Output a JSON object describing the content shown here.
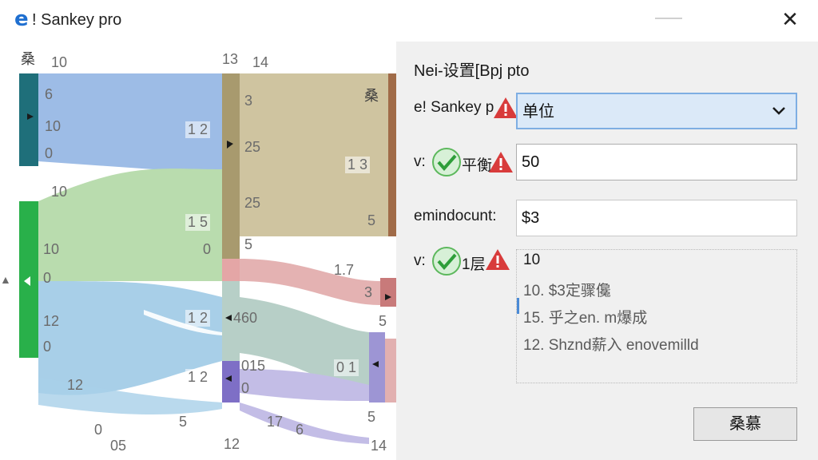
{
  "window": {
    "app_icon_glyph": "e",
    "title": "! Sankey pro",
    "close_glyph": "✕"
  },
  "chart": {
    "colors": {
      "teal": "#1f6f7a",
      "green": "#29b04a",
      "blue_flow": "#9dbce6",
      "green_flow": "#b9dcae",
      "lightblue_flow": "#a8cfe8",
      "tan": "#a89a6e",
      "tan_flow": "#cfc4a0",
      "pink_flow": "#e4b2b2",
      "purple": "#7e6fc6",
      "purple_flow": "#c3bde6",
      "brown": "#a06b48",
      "rose": "#c87a7a",
      "gray_teal_flow": "#b7cfc7"
    },
    "labels": {
      "top_left_glyph": "桑",
      "top_left_num": "10",
      "teal_a": "6",
      "teal_b": "10",
      "teal_c": "0",
      "green_top": "10",
      "green_a": "10",
      "green_b": "0",
      "green_c": "12",
      "green_d": "0",
      "left_edge": "▲",
      "bottom_a": "12",
      "bottom_b": "0",
      "bottom_c": "05",
      "bottom_d": "5",
      "mid_top_a": "13",
      "mid_top_b": "14",
      "mid_a": "1 2",
      "mid_b": "1 5",
      "mid_c": "1 2",
      "mid_d": "1 2",
      "mid_zero": "0",
      "mid_bottom": "12",
      "tan_a": "3",
      "tan_b": "25",
      "tan_c": "25",
      "tan_d": "5",
      "tan_e": "460",
      "purple_a": "015",
      "purple_b": "0",
      "flow_17": "17",
      "flow_6": "6",
      "right_glyph": "桑",
      "right_a": "1 3",
      "right_b": "5",
      "right_c": "1.7",
      "right_d": "3",
      "right_e": "5",
      "right_f": "0 1",
      "right_g": "5",
      "right_bottom": "14"
    }
  },
  "panel": {
    "title": "Nei-设置[Bpj pto",
    "row1_label": "e! Sankey p",
    "select_value": "单位",
    "row2_label_prefix": "v:",
    "row2_label_suffix": "平衡",
    "input1_value": "50",
    "row3_label": "emindocunt:",
    "input2_value": "$3",
    "row4_label_prefix": "v:",
    "row4_label_suffix": "1层",
    "list_items": [
      "10",
      "10. $3定骤儳",
      "15. 乎之en. m爆成",
      "12. Shznd薪入 enovemilld"
    ],
    "button_label": "桑慕"
  }
}
